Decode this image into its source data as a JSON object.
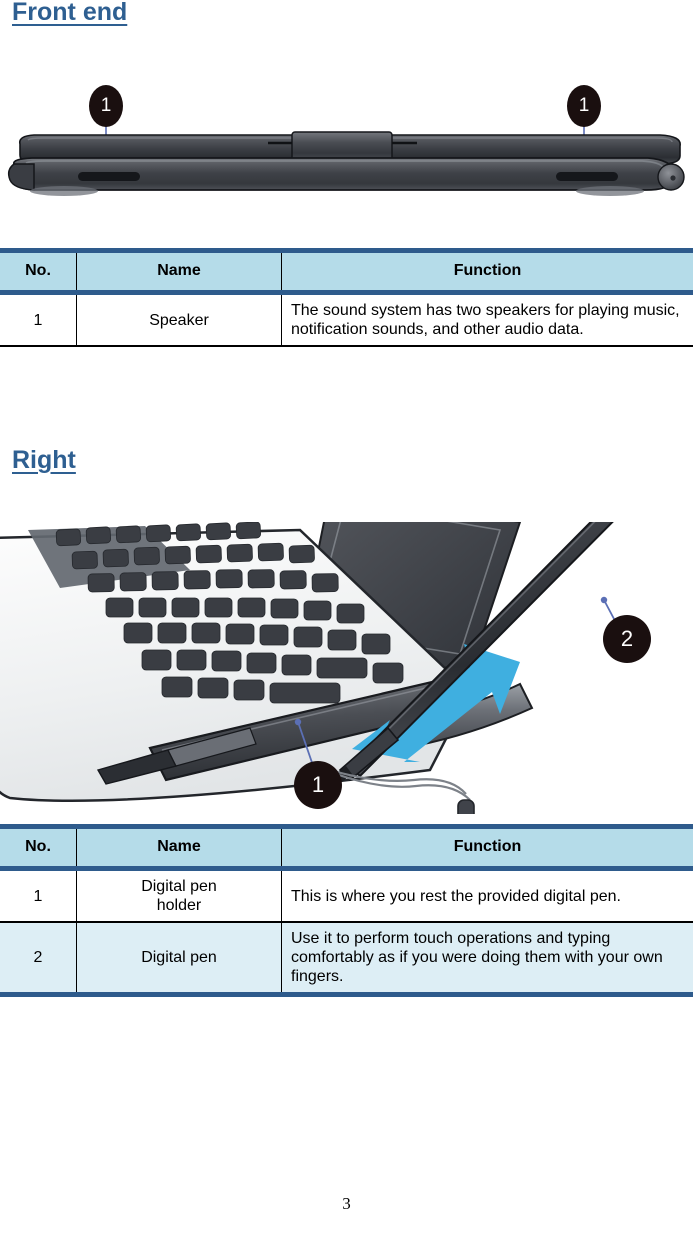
{
  "document": {
    "page_number": "3"
  },
  "sections": [
    {
      "heading": "Front end",
      "figure": {
        "name": "front-end-device-illustration",
        "callouts": [
          {
            "label": "1"
          },
          {
            "label": "1"
          }
        ]
      },
      "table": {
        "headers": [
          "No.",
          "Name",
          "Function"
        ],
        "rows": [
          {
            "no": "1",
            "name": "Speaker",
            "function": "The sound system has two speakers for playing music, notification sounds, and other audio data."
          }
        ]
      }
    },
    {
      "heading": "Right",
      "figure": {
        "name": "right-side-digital-pen-illustration",
        "callouts": [
          {
            "label": "1"
          },
          {
            "label": "2"
          }
        ]
      },
      "table": {
        "headers": [
          "No.",
          "Name",
          "Function"
        ],
        "rows": [
          {
            "no": "1",
            "name_line1": "Digital pen",
            "name_line2": "holder",
            "function": "This is where you rest the provided digital pen."
          },
          {
            "no": "2",
            "name_line1": "Digital pen",
            "name_line2": "",
            "function": "Use it to perform touch operations and typing comfortably as if you were doing them with your own fingers."
          }
        ]
      }
    }
  ],
  "colors": {
    "heading": "#2E5F91",
    "table_header_bg": "#B5DCE9",
    "table_header_border": "#2E5B8C",
    "alt_row_bg": "#DDEEF5",
    "callout_bg": "#1A0F0F",
    "arrow_blue": "#3FAFE0",
    "leader_line": "#5B6FB5"
  }
}
